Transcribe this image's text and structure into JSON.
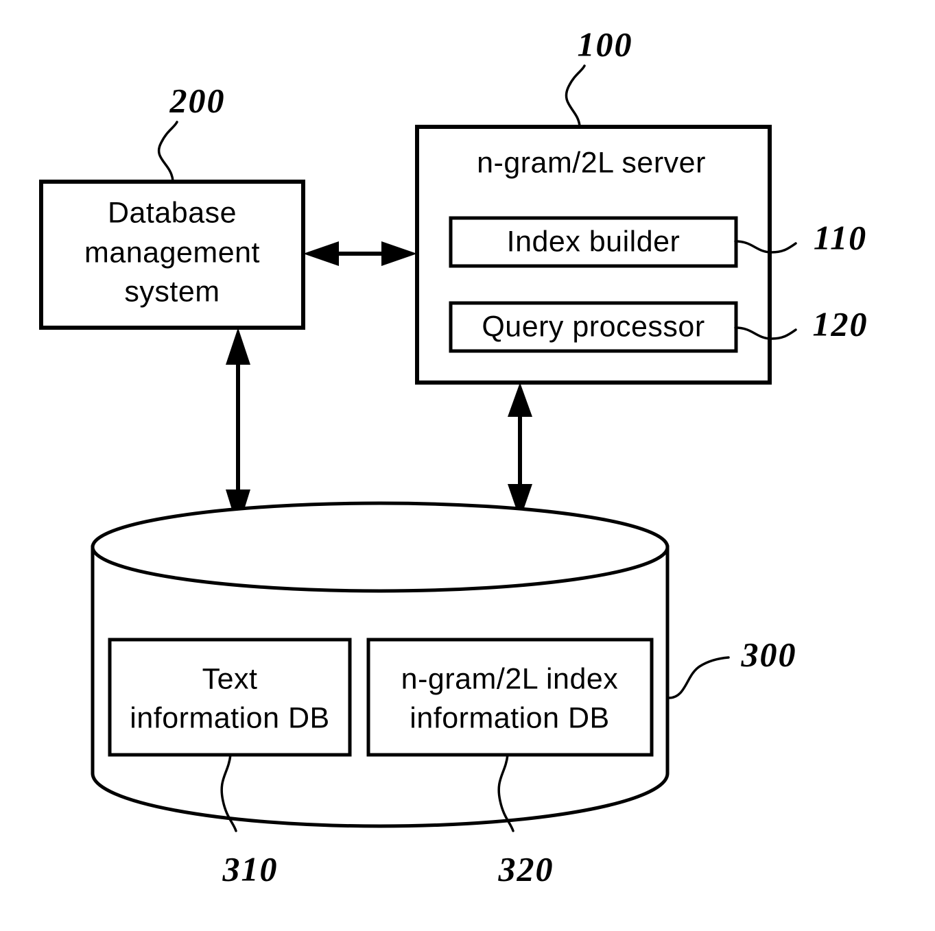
{
  "figure": {
    "type": "patent-system-block-diagram",
    "background_color": "#ffffff",
    "line_color": "#000000"
  },
  "blocks": {
    "dbms": {
      "label_line1": "Database",
      "label_line2": "management",
      "label_line3": "system",
      "ref": "200"
    },
    "server": {
      "title": "n-gram/2L server",
      "ref": "100",
      "components": [
        {
          "label": "Index builder",
          "ref": "110"
        },
        {
          "label": "Query processor",
          "ref": "120"
        }
      ]
    },
    "storage": {
      "ref": "300",
      "databases": [
        {
          "label_line1": "Text",
          "label_line2": "information DB",
          "ref": "310"
        },
        {
          "label_line1": "n-gram/2L index",
          "label_line2": "information DB",
          "ref": "320"
        }
      ]
    }
  },
  "connectors": [
    {
      "name": "dbms-to-server",
      "kind": "double-arrow",
      "orientation": "horizontal"
    },
    {
      "name": "dbms-to-storage",
      "kind": "double-arrow",
      "orientation": "vertical"
    },
    {
      "name": "server-to-storage",
      "kind": "double-arrow",
      "orientation": "vertical"
    }
  ]
}
